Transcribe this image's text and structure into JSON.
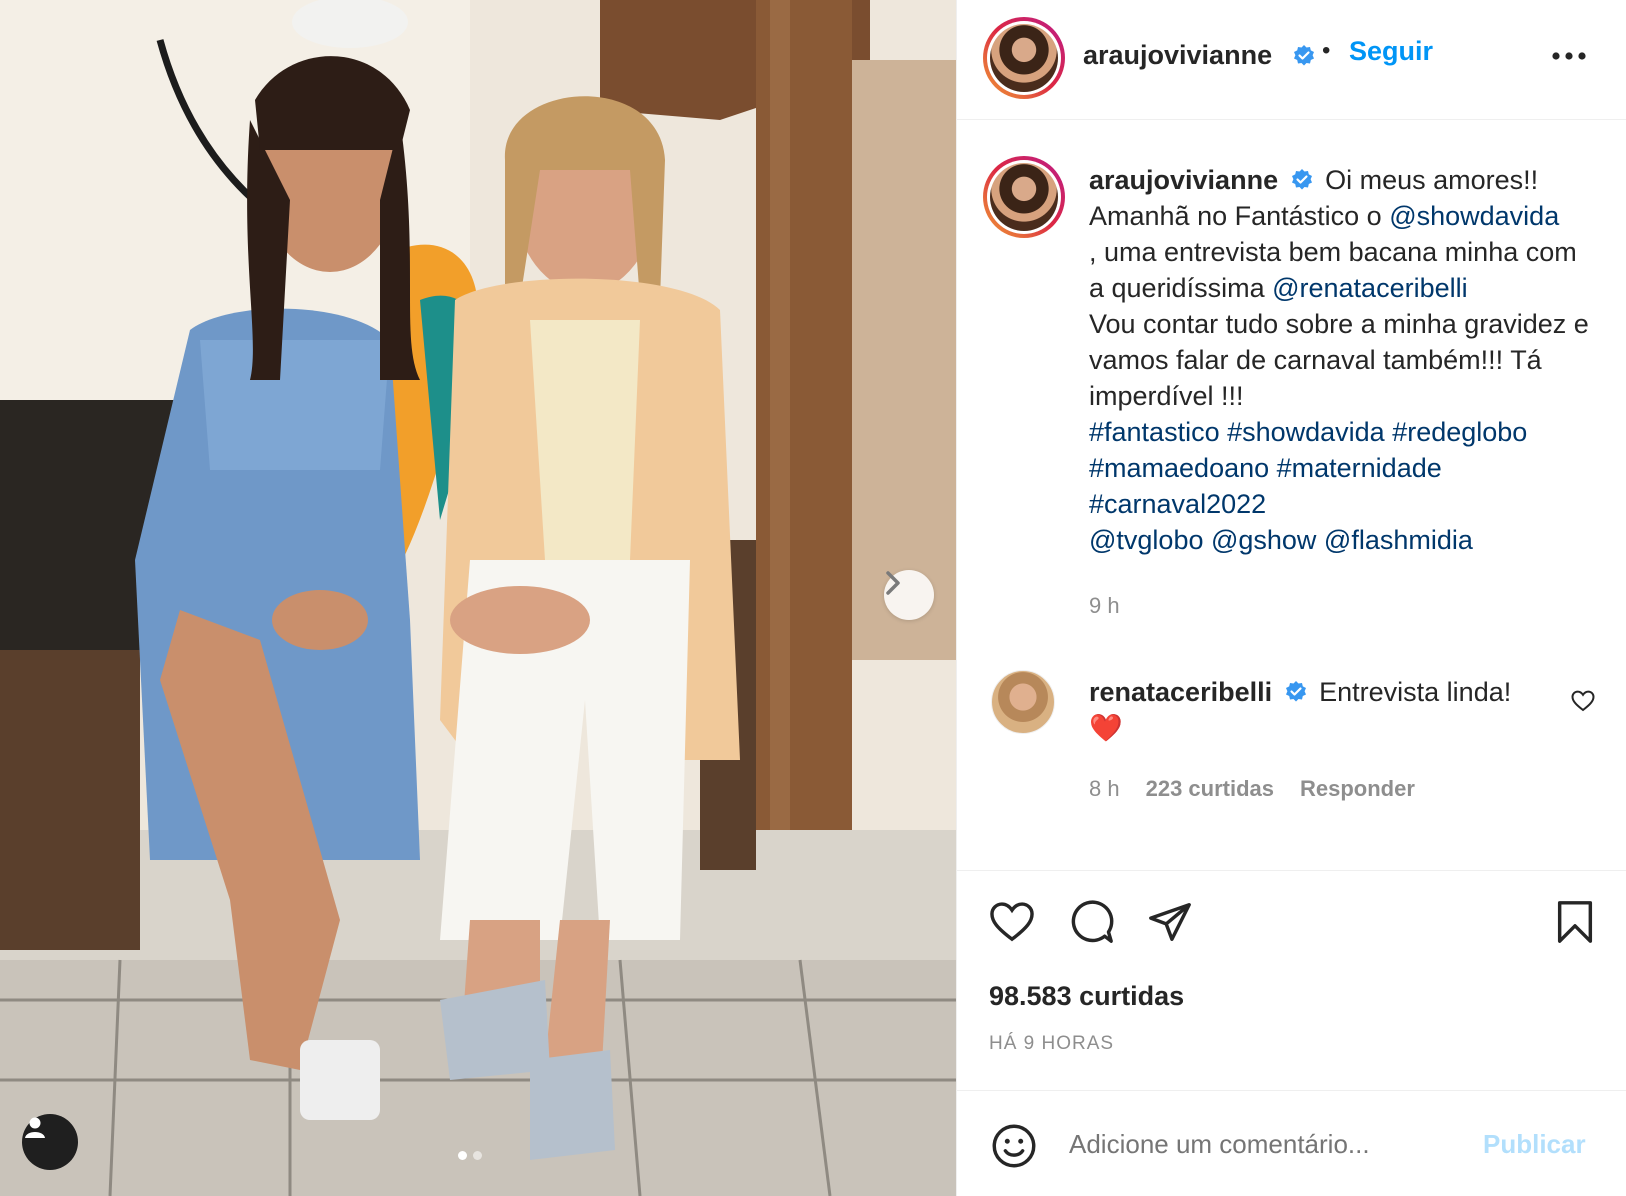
{
  "post": {
    "author": "araujovivianne",
    "follow_label": "Seguir",
    "bullet": "•",
    "caption_intro": "Oi meus amores!! Amanhã no Fantástico o",
    "mention1": "@showdavida",
    "caption_mid": ", uma entrevista bem bacana minha com a queridíssima",
    "mention2": "@renataceribelli",
    "caption_rest": "Vou contar tudo sobre a minha gravidez e vamos falar de carnaval também!!! Tá imperdível !!!",
    "hashtags_line1": "#fantastico #showdavida #redeglobo",
    "hashtags_line2": "#mamaedoano #maternidade",
    "hashtags_line3": "#carnaval2022",
    "mentions_line": "@tvglobo @gshow @flashmidia",
    "caption_time": "9 h"
  },
  "comment": {
    "author": "renataceribelli",
    "text": "Entrevista linda!",
    "emoji": "❤️",
    "time": "8 h",
    "likes": "223 curtidas",
    "reply_label": "Responder"
  },
  "stats": {
    "likes": "98.583 curtidas",
    "date": "HÁ 9 HORAS"
  },
  "composer": {
    "placeholder": "Adicione um comentário...",
    "publish_label": "Publicar"
  },
  "icons": {
    "like": "heart-icon",
    "comment": "comment-icon",
    "share": "send-icon",
    "save": "bookmark-icon",
    "emoji": "emoji-icon",
    "more": "more-icon",
    "verified": "verified-badge-icon",
    "next": "chevron-right-icon",
    "tags": "user-tag-icon"
  },
  "colors": {
    "link": "#00376b",
    "follow": "#0095f6",
    "muted": "#8e8e8e",
    "publish_disabled": "#b2dffc",
    "verified": "#3897f0",
    "heart": "#ed4956"
  },
  "carousel": {
    "slide_count": 2,
    "active_index": 0
  }
}
